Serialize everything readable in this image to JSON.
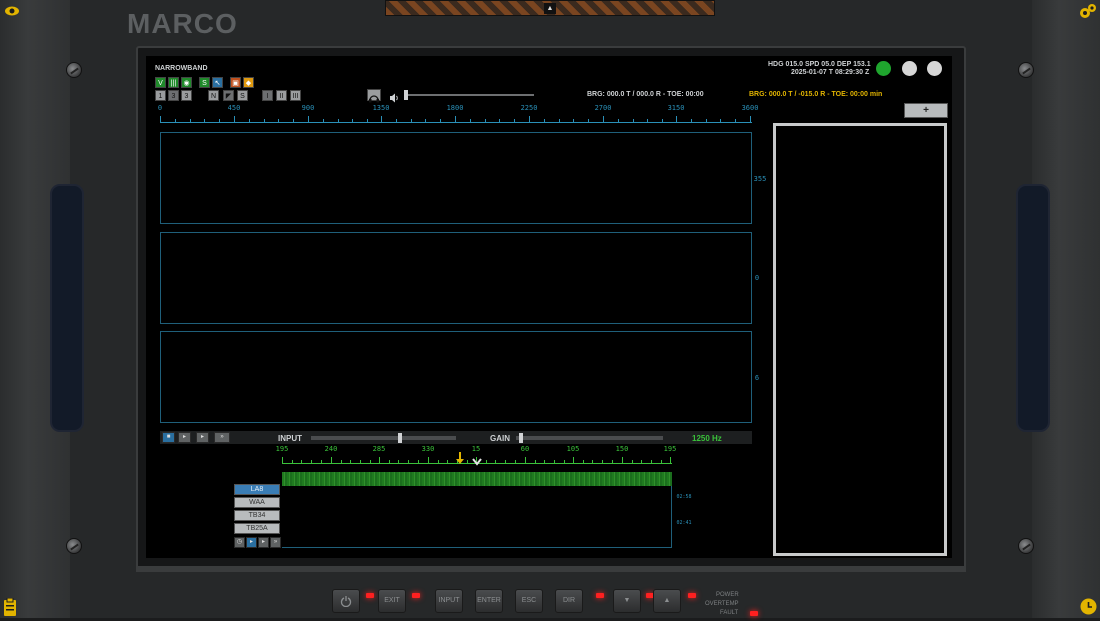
{
  "app": {
    "logo": "MARCO"
  },
  "header": {
    "mode": "NARROWBAND"
  },
  "status": {
    "nav": "HDG 015.0  SPD 05.0  DEP 153.1",
    "datetime": "2025-01-07 T 08:29:30 Z",
    "bearing_white": "BRG: 000.0 T / 000.0 R - TOE: 00:00",
    "bearing_yellow": "BRG: 000.0 T / -015.0 R - TOE: 00:00 min"
  },
  "toolbar": {
    "top_buttons": [
      "V",
      "|||",
      "◉",
      "S",
      "↖",
      "▣",
      "◆"
    ],
    "num_buttons": [
      "1",
      "3",
      "3",
      "N",
      "◤",
      "S",
      "I",
      "II",
      "III"
    ]
  },
  "bearing_axis": {
    "ticks": [
      "0",
      "450",
      "900",
      "1350",
      "1800",
      "2250",
      "2700",
      "3150",
      "3600"
    ]
  },
  "plot_side_labels": [
    "355",
    "0",
    "6"
  ],
  "controls": {
    "input_label": "INPUT",
    "gain_label": "GAIN",
    "frequency": "1250 Hz",
    "input_level": 0.62,
    "gain_level": 0.02
  },
  "playback_buttons": [
    "■",
    "▸",
    "▸",
    "»"
  ],
  "narrow_axis": {
    "ticks": [
      "195",
      "240",
      "285",
      "330",
      "15",
      "60",
      "105",
      "150",
      "195"
    ]
  },
  "stations": [
    "LA8",
    "WAA",
    "TB34",
    "TB25A"
  ],
  "station_controls": [
    "◷",
    "▸",
    "▸",
    "»"
  ],
  "waterfall_times": [
    "02:58",
    "02:41"
  ],
  "panel_buttons": {
    "power_icon": "power-icon",
    "exit": "EXIT",
    "input": "INPUT",
    "enter": "ENTER",
    "esc": "ESC",
    "dir": "DIR",
    "down": "▼",
    "up": "▲"
  },
  "indicators": {
    "power": "POWER",
    "overtemp": "OVERTEMP",
    "fault": "FAULT"
  },
  "expand_button": "+",
  "colors": {
    "accent_blue": "#2a90b8",
    "green": "#3ac23a",
    "yellow": "#e2b400",
    "led_red": "#ff2020",
    "status_green": "#1fa52e"
  }
}
